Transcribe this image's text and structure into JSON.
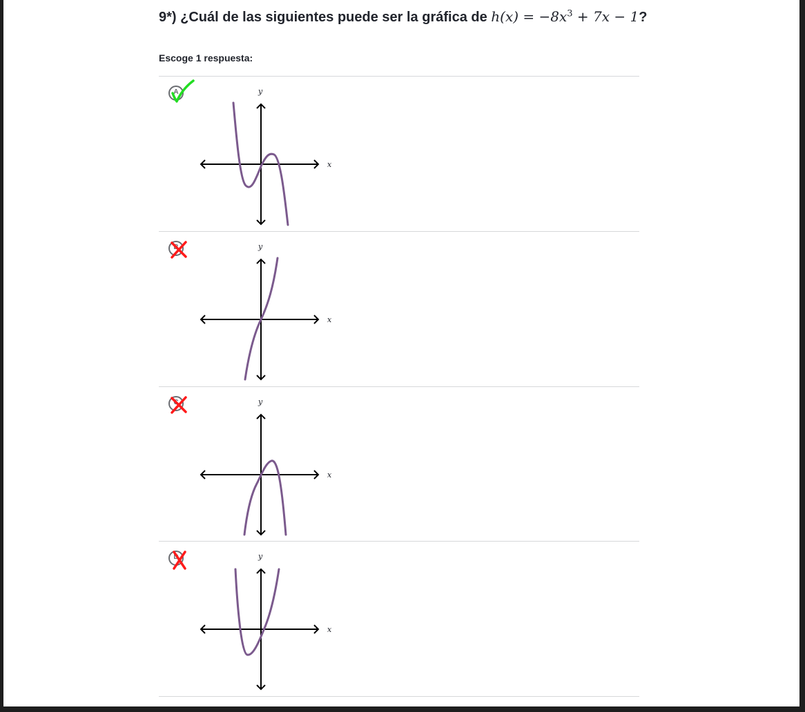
{
  "question": {
    "prefix": "9*) ¿Cuál de las siguientes puede ser la gráfica de ",
    "math_func": "h(x) = −8x",
    "math_exp": "3",
    "math_rest": " + 7x − 1",
    "suffix": "?"
  },
  "instructions": "Escoge 1 respuesta:",
  "choices": [
    {
      "letter": "A",
      "mark": "check",
      "x_label": "x",
      "y_label": "y"
    },
    {
      "letter": "B",
      "mark": "cross",
      "x_label": "x",
      "y_label": "y"
    },
    {
      "letter": "C",
      "mark": "cross",
      "x_label": "x",
      "y_label": "y"
    },
    {
      "letter": "D",
      "mark": "cross",
      "x_label": "x",
      "y_label": "y"
    }
  ],
  "colors": {
    "curve": "#7b5a8d",
    "check": "#22dd22",
    "cross": "#ff1a1a",
    "divider": "#d6d8da"
  }
}
